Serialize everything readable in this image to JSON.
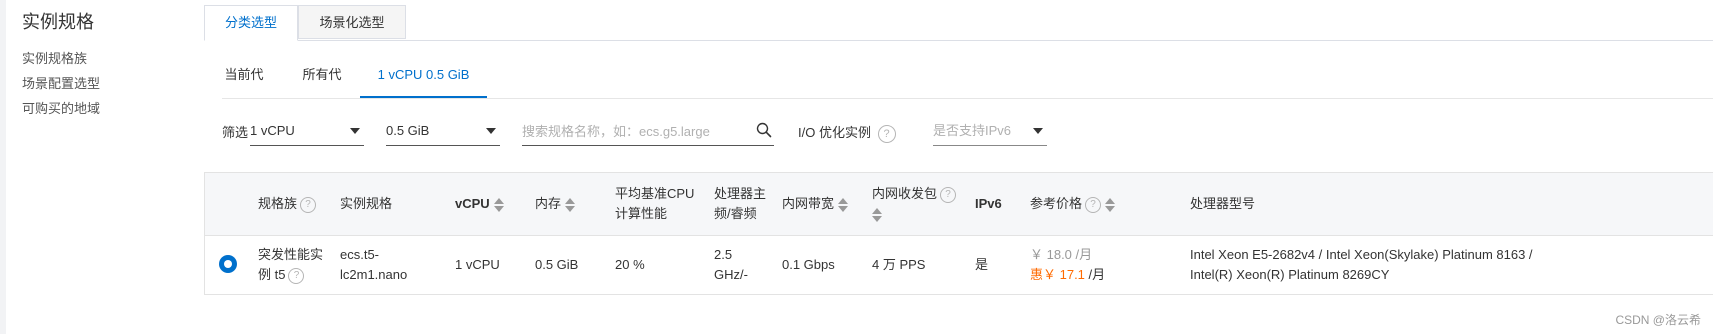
{
  "sidebar": {
    "title": "实例规格",
    "items": [
      "实例规格族",
      "场景配置选型",
      "可购买的地域"
    ]
  },
  "main_tabs": [
    "分类选型",
    "场景化选型"
  ],
  "sub_tabs": [
    "当前代",
    "所有代",
    "1 vCPU 0.5 GiB"
  ],
  "filter": {
    "label": "筛选",
    "vcpu": "1 vCPU",
    "memory": "0.5 GiB",
    "search_placeholder": "搜索规格名称，如：ecs.g5.large",
    "io_label": "I/O 优化实例",
    "ipv6_placeholder": "是否支持IPv6"
  },
  "table": {
    "headers": {
      "family": "规格族",
      "spec": "实例规格",
      "vcpu": "vCPU",
      "memory": "内存",
      "cpu_baseline_1": "平均基准CPU",
      "cpu_baseline_2": "计算性能",
      "freq_1": "处理器主",
      "freq_2": "频/睿频",
      "bandwidth": "内网带宽",
      "pps": "内网收发包",
      "ipv6": "IPv6",
      "price": "参考价格",
      "processor": "处理器型号"
    },
    "row": {
      "family_1": "突发性能实",
      "family_2": "例 t5",
      "spec_1": "ecs.t5-",
      "spec_2": "lc2m1.nano",
      "vcpu": "1 vCPU",
      "memory": "0.5 GiB",
      "cpu_baseline": "20 %",
      "freq_1": "2.5",
      "freq_2": "GHz/-",
      "bandwidth": "0.1 Gbps",
      "pps": "4 万 PPS",
      "ipv6": "是",
      "price_original": "￥ 18.0",
      "price_unit": "/月",
      "price_discount": "惠￥ 17.1",
      "processor_1": "Intel Xeon E5-2682v4 / Intel Xeon(Skylake) Platinum 8163 /",
      "processor_2": "Intel(R) Xeon(R) Platinum 8269CY"
    }
  },
  "watermark": "CSDN @洛云希",
  "colors": {
    "accent": "#0070cc",
    "discount": "#ff6a00"
  }
}
